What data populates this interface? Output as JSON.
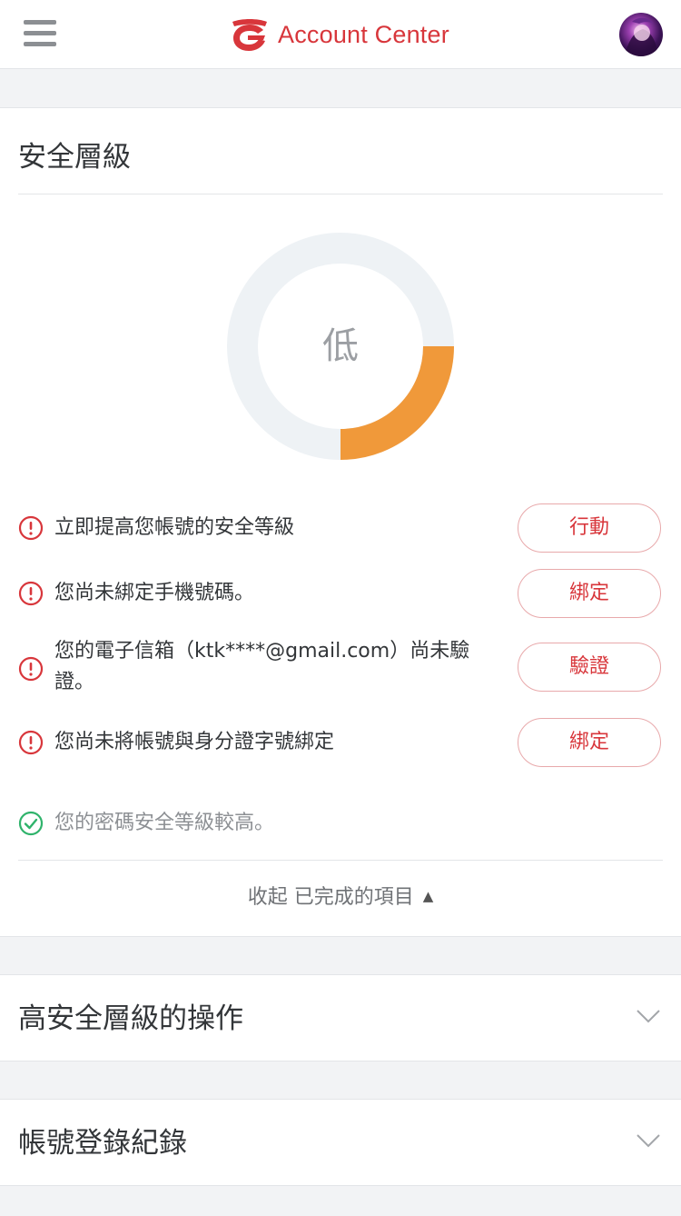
{
  "header": {
    "title": "Account Center",
    "brand_color": "#d8363b",
    "menu_icon": "hamburger-menu-icon",
    "avatar_icon": "user-avatar"
  },
  "security": {
    "title": "安全層級",
    "level_label": "低",
    "level_fraction": 0.25,
    "level_color": "#f0993a",
    "tasks": [
      {
        "text": "立即提高您帳號的安全等級",
        "button": "行動",
        "icon": "alert-circle-icon"
      },
      {
        "text": "您尚未綁定手機號碼。",
        "button": "綁定",
        "icon": "alert-circle-icon"
      },
      {
        "text": "您的電子信箱（ktk****@gmail.com）尚未驗證。",
        "button": "驗證",
        "icon": "alert-circle-icon"
      },
      {
        "text": "您尚未將帳號與身分證字號綁定",
        "button": "綁定",
        "icon": "alert-circle-icon"
      }
    ],
    "completed": [
      {
        "text": "您的密碼安全等級較高。",
        "icon": "check-circle-icon"
      }
    ],
    "collapse_label": "收起 已完成的項目",
    "collapse_icon": "triangle-up-icon"
  },
  "sections": [
    {
      "title": "高安全層級的操作",
      "icon": "chevron-down-icon"
    },
    {
      "title": "帳號登錄紀錄",
      "icon": "chevron-down-icon"
    }
  ],
  "colors": {
    "alert": "#d8363b",
    "success": "#2fb36b",
    "gauge_track": "#eef2f5"
  }
}
